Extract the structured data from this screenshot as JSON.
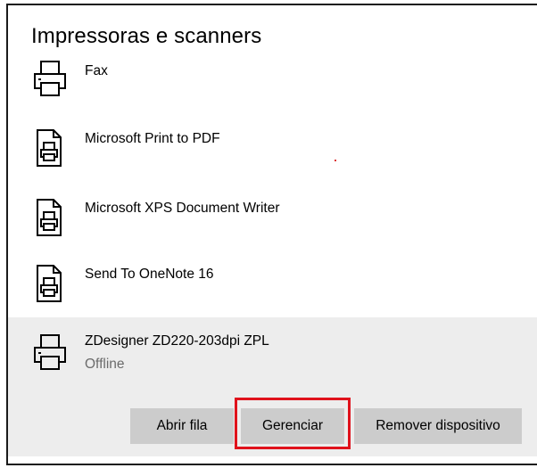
{
  "header": {
    "title": "Impressoras e scanners"
  },
  "devices": [
    {
      "name": "Fax",
      "icon": "printer-icon"
    },
    {
      "name": "Microsoft Print to PDF",
      "icon": "document-printer-icon"
    },
    {
      "name": "Microsoft XPS Document Writer",
      "icon": "document-printer-icon"
    },
    {
      "name": "Send To OneNote 16",
      "icon": "document-printer-icon"
    },
    {
      "name": "ZDesigner ZD220-203dpi ZPL",
      "status": "Offline",
      "icon": "printer-icon",
      "selected": true
    }
  ],
  "actions": {
    "open_queue": "Abrir fila",
    "manage": "Gerenciar",
    "remove": "Remover dispositivo"
  },
  "colors": {
    "selected_bg": "#ededed",
    "button_bg": "#cccccc",
    "highlight_border": "#e0121c"
  }
}
